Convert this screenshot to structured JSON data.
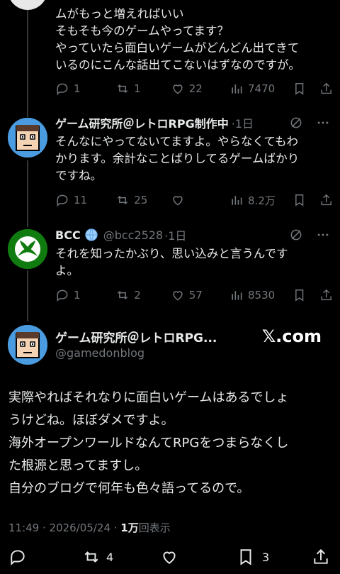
{
  "tweet1": {
    "text": "ムがもっと増えればいい\nそもそも今のゲームやってます？\nやっていたら面白いゲームがどんどん出てきて\nいるのにこんな話出てこないはずなのですが。",
    "replies": "1",
    "retweets": "1",
    "likes": "22",
    "views": "7470"
  },
  "tweet2": {
    "name": "ゲーム研究所＠レトロRPG制作中",
    "time": "·1日",
    "text": "そんなにやってないてますよ。やらなくてもわ\nかります。余計なことばりしてるゲームばかり\nですね。",
    "replies": "11",
    "retweets": "25",
    "likes": "",
    "views": "8.2万"
  },
  "tweet3": {
    "name": "BCC",
    "handle": "@bcc2528",
    "time": "·1日",
    "text": "それを知ったかぶり、思い込みと言うんです\nよ。",
    "replies": "1",
    "retweets": "2",
    "likes": "57",
    "views": "8530"
  },
  "main": {
    "name": "ゲーム研究所＠レトロRPG...",
    "handle": "@gamedonblog",
    "watermark": "𝕏.com",
    "text": "実際やればそれなりに面白いゲームはあるでしょ\nうけどね。ほぼダメですよ。\n海外オープンワールドなんてRPGをつまらなくし\nた根源と思ってますし。\n自分のブログで何年も色々語ってるので。",
    "timestamp": "11:49 · 2026/05/24 · ",
    "views_count": "1万",
    "views_label": "回表示",
    "retweets": "4",
    "bookmarks": "3"
  },
  "colors": {
    "bg": "#000000",
    "text": "#e7e9ea",
    "muted": "#71767b",
    "line": "#333639",
    "xbox": "#107c10"
  }
}
